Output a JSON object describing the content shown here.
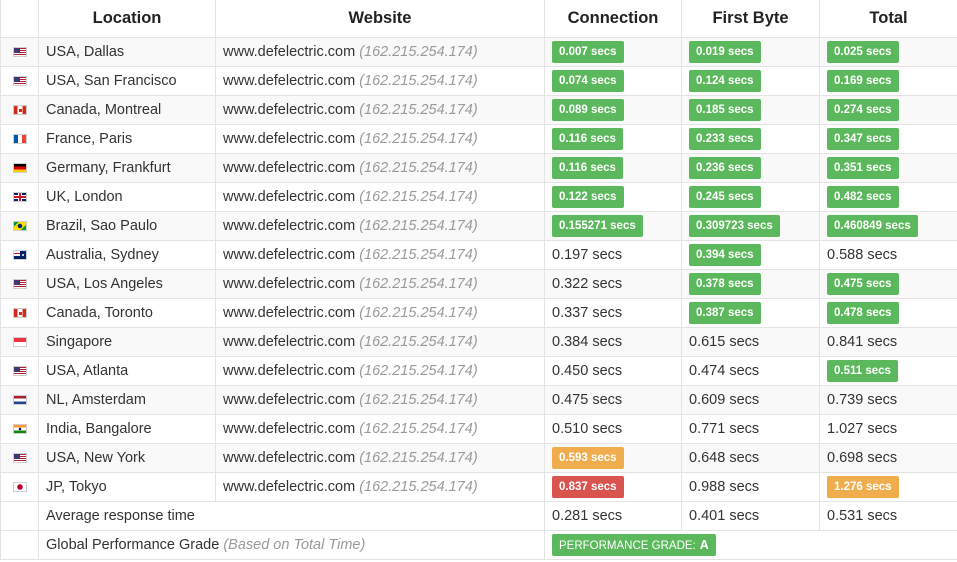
{
  "headers": {
    "location": "Location",
    "website": "Website",
    "connection": "Connection",
    "first_byte": "First Byte",
    "total": "Total"
  },
  "rows": [
    {
      "flag": "us",
      "location": "USA, Dallas",
      "site": "www.defelectric.com",
      "ip": "(162.215.254.174)",
      "connection": {
        "text": "0.007 secs",
        "status": "green"
      },
      "first_byte": {
        "text": "0.019 secs",
        "status": "green"
      },
      "total": {
        "text": "0.025 secs",
        "status": "green"
      }
    },
    {
      "flag": "us",
      "location": "USA, San Francisco",
      "site": "www.defelectric.com",
      "ip": "(162.215.254.174)",
      "connection": {
        "text": "0.074 secs",
        "status": "green"
      },
      "first_byte": {
        "text": "0.124 secs",
        "status": "green"
      },
      "total": {
        "text": "0.169 secs",
        "status": "green"
      }
    },
    {
      "flag": "ca",
      "location": "Canada, Montreal",
      "site": "www.defelectric.com",
      "ip": "(162.215.254.174)",
      "connection": {
        "text": "0.089 secs",
        "status": "green"
      },
      "first_byte": {
        "text": "0.185 secs",
        "status": "green"
      },
      "total": {
        "text": "0.274 secs",
        "status": "green"
      }
    },
    {
      "flag": "fr",
      "location": "France, Paris",
      "site": "www.defelectric.com",
      "ip": "(162.215.254.174)",
      "connection": {
        "text": "0.116 secs",
        "status": "green"
      },
      "first_byte": {
        "text": "0.233 secs",
        "status": "green"
      },
      "total": {
        "text": "0.347 secs",
        "status": "green"
      }
    },
    {
      "flag": "de",
      "location": "Germany, Frankfurt",
      "site": "www.defelectric.com",
      "ip": "(162.215.254.174)",
      "connection": {
        "text": "0.116 secs",
        "status": "green"
      },
      "first_byte": {
        "text": "0.236 secs",
        "status": "green"
      },
      "total": {
        "text": "0.351 secs",
        "status": "green"
      }
    },
    {
      "flag": "gb",
      "location": "UK, London",
      "site": "www.defelectric.com",
      "ip": "(162.215.254.174)",
      "connection": {
        "text": "0.122 secs",
        "status": "green"
      },
      "first_byte": {
        "text": "0.245 secs",
        "status": "green"
      },
      "total": {
        "text": "0.482 secs",
        "status": "green"
      }
    },
    {
      "flag": "br",
      "location": "Brazil, Sao Paulo",
      "site": "www.defelectric.com",
      "ip": "(162.215.254.174)",
      "connection": {
        "text": "0.155271 secs",
        "status": "green"
      },
      "first_byte": {
        "text": "0.309723 secs",
        "status": "green"
      },
      "total": {
        "text": "0.460849 secs",
        "status": "green"
      }
    },
    {
      "flag": "au",
      "location": "Australia, Sydney",
      "site": "www.defelectric.com",
      "ip": "(162.215.254.174)",
      "connection": {
        "text": "0.197 secs",
        "status": "plain"
      },
      "first_byte": {
        "text": "0.394 secs",
        "status": "green"
      },
      "total": {
        "text": "0.588 secs",
        "status": "plain"
      }
    },
    {
      "flag": "us",
      "location": "USA, Los Angeles",
      "site": "www.defelectric.com",
      "ip": "(162.215.254.174)",
      "connection": {
        "text": "0.322 secs",
        "status": "plain"
      },
      "first_byte": {
        "text": "0.378 secs",
        "status": "green"
      },
      "total": {
        "text": "0.475 secs",
        "status": "green"
      }
    },
    {
      "flag": "ca",
      "location": "Canada, Toronto",
      "site": "www.defelectric.com",
      "ip": "(162.215.254.174)",
      "connection": {
        "text": "0.337 secs",
        "status": "plain"
      },
      "first_byte": {
        "text": "0.387 secs",
        "status": "green"
      },
      "total": {
        "text": "0.478 secs",
        "status": "green"
      }
    },
    {
      "flag": "sg",
      "location": "Singapore",
      "site": "www.defelectric.com",
      "ip": "(162.215.254.174)",
      "connection": {
        "text": "0.384 secs",
        "status": "plain"
      },
      "first_byte": {
        "text": "0.615 secs",
        "status": "plain"
      },
      "total": {
        "text": "0.841 secs",
        "status": "plain"
      }
    },
    {
      "flag": "us",
      "location": "USA, Atlanta",
      "site": "www.defelectric.com",
      "ip": "(162.215.254.174)",
      "connection": {
        "text": "0.450 secs",
        "status": "plain"
      },
      "first_byte": {
        "text": "0.474 secs",
        "status": "plain"
      },
      "total": {
        "text": "0.511 secs",
        "status": "green"
      }
    },
    {
      "flag": "nl",
      "location": "NL, Amsterdam",
      "site": "www.defelectric.com",
      "ip": "(162.215.254.174)",
      "connection": {
        "text": "0.475 secs",
        "status": "plain"
      },
      "first_byte": {
        "text": "0.609 secs",
        "status": "plain"
      },
      "total": {
        "text": "0.739 secs",
        "status": "plain"
      }
    },
    {
      "flag": "in",
      "location": "India, Bangalore",
      "site": "www.defelectric.com",
      "ip": "(162.215.254.174)",
      "connection": {
        "text": "0.510 secs",
        "status": "plain"
      },
      "first_byte": {
        "text": "0.771 secs",
        "status": "plain"
      },
      "total": {
        "text": "1.027 secs",
        "status": "plain"
      }
    },
    {
      "flag": "us",
      "location": "USA, New York",
      "site": "www.defelectric.com",
      "ip": "(162.215.254.174)",
      "connection": {
        "text": "0.593 secs",
        "status": "orange"
      },
      "first_byte": {
        "text": "0.648 secs",
        "status": "plain"
      },
      "total": {
        "text": "0.698 secs",
        "status": "plain"
      }
    },
    {
      "flag": "jp",
      "location": "JP, Tokyo",
      "site": "www.defelectric.com",
      "ip": "(162.215.254.174)",
      "connection": {
        "text": "0.837 secs",
        "status": "red"
      },
      "first_byte": {
        "text": "0.988 secs",
        "status": "plain"
      },
      "total": {
        "text": "1.276 secs",
        "status": "orange"
      }
    }
  ],
  "average": {
    "label": "Average response time",
    "connection": "0.281 secs",
    "first_byte": "0.401 secs",
    "total": "0.531 secs"
  },
  "grade": {
    "label": "Global Performance Grade",
    "note": "(Based on Total Time)",
    "badge_text": "PERFORMANCE GRADE:",
    "badge_value": "A"
  },
  "colors": {
    "green": "#5cb85c",
    "orange": "#f0ad4e",
    "red": "#d9534f"
  }
}
